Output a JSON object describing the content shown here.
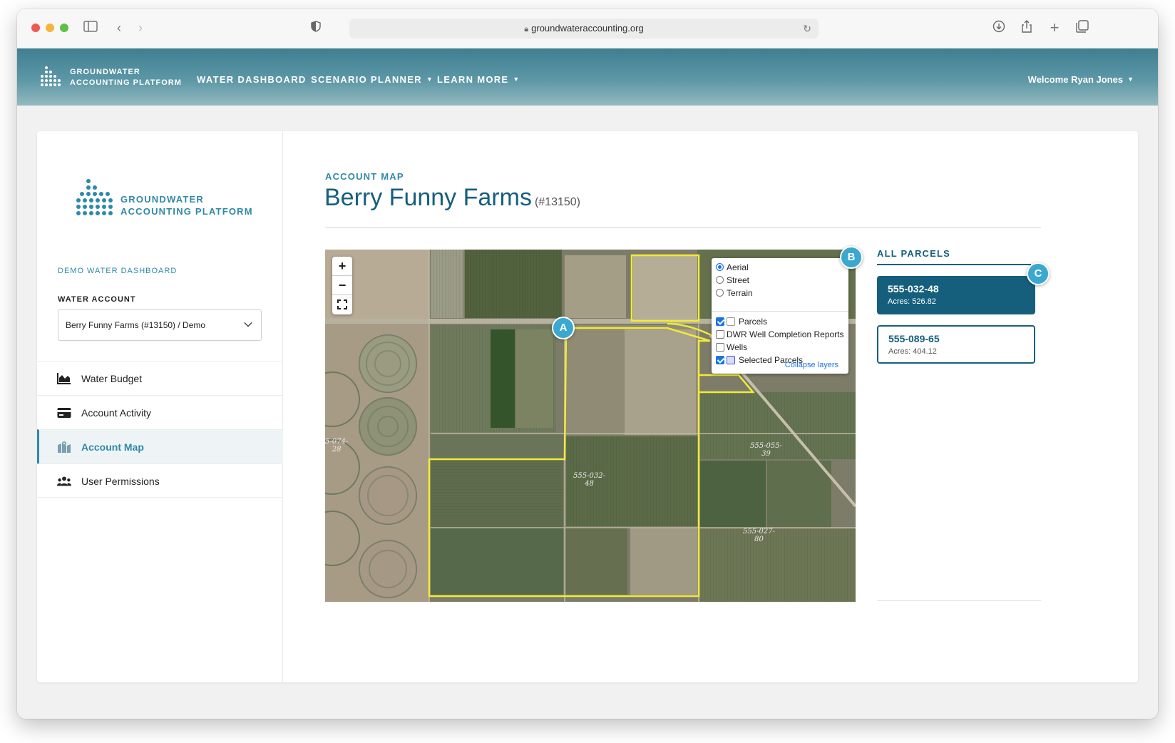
{
  "browser": {
    "url": "groundwateraccounting.org"
  },
  "topnav": {
    "brand_line1": "GROUNDWATER",
    "brand_line2": "ACCOUNTING PLATFORM",
    "items": [
      {
        "label": "WATER DASHBOARD"
      },
      {
        "label": "SCENARIO PLANNER"
      },
      {
        "label": "LEARN MORE"
      }
    ],
    "welcome": "Welcome Ryan Jones"
  },
  "sidebar": {
    "brand_line1": "GROUNDWATER",
    "brand_line2": "ACCOUNTING PLATFORM",
    "section_label": "DEMO WATER DASHBOARD",
    "water_account_label": "WATER ACCOUNT",
    "water_account_value": "Berry Funny Farms (#13150) / Demo",
    "items": [
      {
        "label": "Water Budget",
        "icon": "area-chart-icon"
      },
      {
        "label": "Account Activity",
        "icon": "credit-card-icon"
      },
      {
        "label": "Account Map",
        "icon": "map-icon",
        "active": true
      },
      {
        "label": "User Permissions",
        "icon": "users-icon"
      }
    ]
  },
  "main": {
    "eyebrow": "ACCOUNT MAP",
    "title": "Berry Funny Farms",
    "account_number": "(#13150)"
  },
  "map": {
    "zoom_in": "+",
    "zoom_out": "−",
    "base_layers": [
      {
        "label": "Aerial",
        "selected": true
      },
      {
        "label": "Street",
        "selected": false
      },
      {
        "label": "Terrain",
        "selected": false
      }
    ],
    "overlays": [
      {
        "label": "Parcels",
        "checked": true
      },
      {
        "label": "DWR Well Completion Reports",
        "checked": false
      },
      {
        "label": "Wells",
        "checked": false
      },
      {
        "label": "Selected Parcels",
        "checked": true
      }
    ],
    "collapse_label": "Collapse layers",
    "markers": [
      "A",
      "B",
      "C"
    ],
    "parcel_labels": [
      {
        "line1": "555-032-",
        "line2": "48"
      },
      {
        "line1": "555-055-",
        "line2": "39"
      },
      {
        "line1": "555-027-",
        "line2": "80"
      },
      {
        "line1": "5-074-",
        "line2": "28"
      }
    ],
    "colors": {
      "selected_parcel": "#f2ea3a",
      "parcel_outline": "#ffffff"
    }
  },
  "parcels": {
    "title": "ALL PARCELS",
    "items": [
      {
        "id": "555-032-48",
        "acres": "Acres: 526.82",
        "selected": true
      },
      {
        "id": "555-089-65",
        "acres": "Acres: 404.12",
        "selected": false
      }
    ]
  },
  "colors": {
    "accent": "#2f89a8",
    "primary": "#155f7d",
    "marker": "#3aa8cf"
  }
}
